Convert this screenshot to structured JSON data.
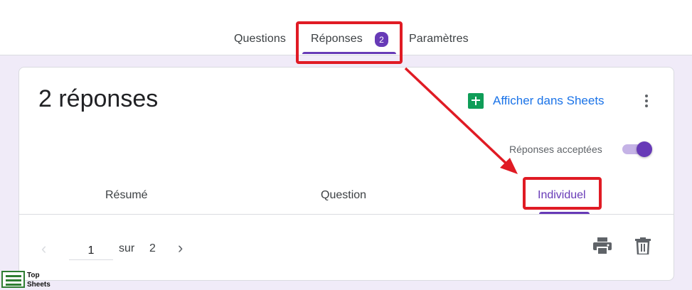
{
  "top_tabs": {
    "questions": "Questions",
    "responses": "Réponses",
    "responses_badge": "2",
    "settings": "Paramètres"
  },
  "summary": {
    "count_title": "2 réponses",
    "sheets_link": "Afficher dans Sheets",
    "accepting_label": "Réponses acceptées",
    "accepting_on": true
  },
  "sub_tabs": {
    "summary": "Résumé",
    "question": "Question",
    "individual": "Individuel",
    "active": "individual"
  },
  "pager": {
    "current": "1",
    "of_label": "sur",
    "total": "2"
  },
  "icons": {
    "sheets": "google-sheets-icon",
    "more": "more-vert-icon",
    "prev": "chevron-left-icon",
    "next": "chevron-right-icon",
    "print": "print-icon",
    "delete": "trash-icon"
  },
  "colors": {
    "accent": "#673ab7",
    "link": "#1a73e8",
    "sheets_green": "#0f9d58",
    "annotation_red": "#e01b24",
    "page_bg": "#f0ebf8"
  },
  "watermark": {
    "line1": "Top",
    "line2": "Sheets"
  }
}
